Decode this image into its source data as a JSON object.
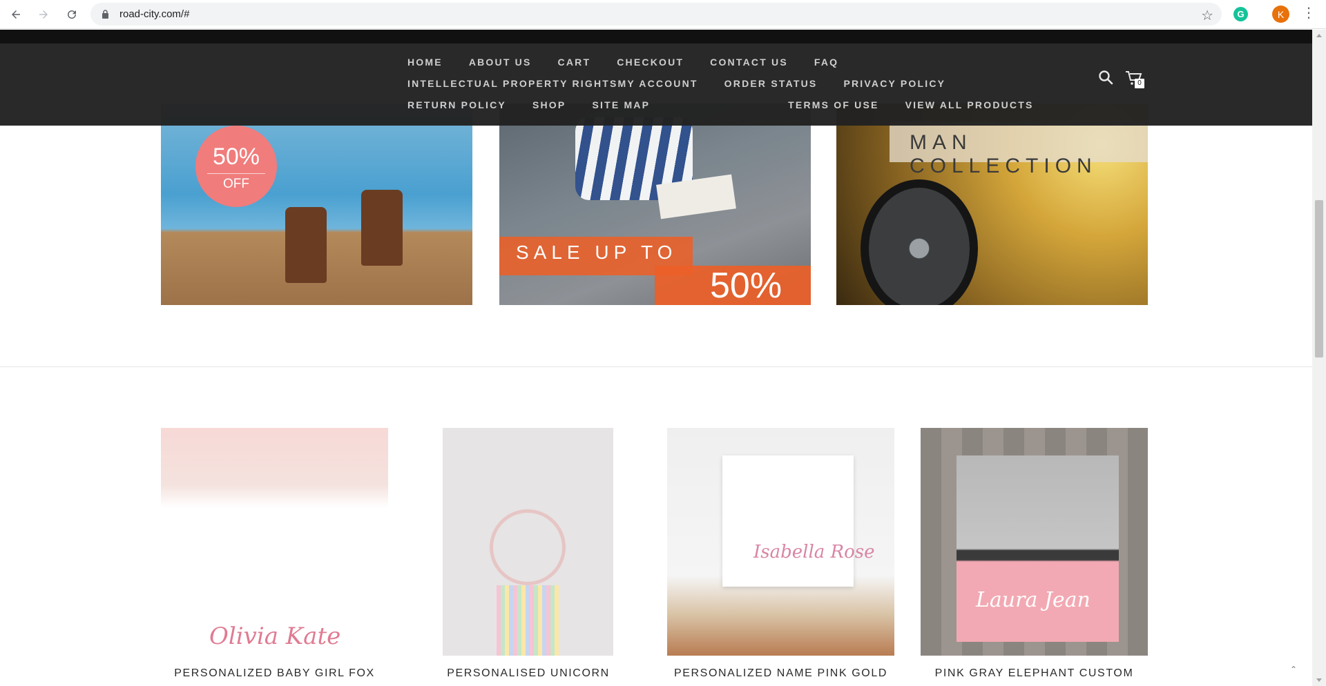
{
  "browser": {
    "url": "road-city.com/#",
    "profile_initial": "K",
    "extension_initial": "G"
  },
  "header": {
    "menu": [
      "HOME",
      "ABOUT US",
      "CART",
      "CHECKOUT",
      "CONTACT US",
      "FAQ",
      "INTELLECTUAL PROPERTY RIGHTS",
      "MY ACCOUNT",
      "ORDER STATUS",
      "PRIVACY POLICY",
      "RETURN POLICY",
      "SHOP",
      "SITE MAP",
      "TERMS OF USE",
      "VIEW ALL PRODUCTS"
    ],
    "cart_count": "0"
  },
  "banners": {
    "first": {
      "percent": "50%",
      "off": "OFF"
    },
    "second": {
      "sale_text": "SALE UP TO",
      "sale_percent": "50%"
    },
    "third": {
      "title": "MAN COLLECTION"
    }
  },
  "products": [
    {
      "name": "PERSONALIZED BABY GIRL FOX",
      "image_text": "Olivia Kate"
    },
    {
      "name": "PERSONALISED UNICORN"
    },
    {
      "name": "PERSONALIZED NAME PINK GOLD",
      "image_text": "Isabella Rose"
    },
    {
      "name": "PINK GRAY ELEPHANT CUSTOM",
      "image_text": "Laura Jean"
    }
  ]
}
